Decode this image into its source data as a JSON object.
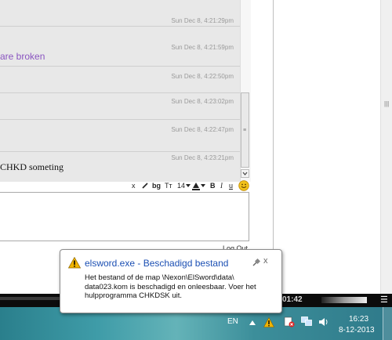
{
  "chat": {
    "messages": [
      {
        "time": "Sun Dec 8, 4:21:29pm",
        "text": ""
      },
      {
        "time": "Sun Dec 8, 4:21:59pm",
        "text": "are broken"
      },
      {
        "time": "Sun Dec 8, 4:22:50pm",
        "text": ""
      },
      {
        "time": "Sun Dec 8, 4:23:02pm",
        "text": ""
      },
      {
        "time": "Sun Dec 8, 4:22:47pm",
        "text": ""
      },
      {
        "time": "Sun Dec 8, 4:23:21pm",
        "text": "CHKD someting"
      }
    ],
    "link_color": "#8a55c0"
  },
  "toolbar": {
    "close": "x",
    "pen": "",
    "bg": "bg",
    "tt": "Tт",
    "size": "14",
    "bold": "B",
    "italic": "I",
    "underline": "u"
  },
  "logout": "Log Out",
  "notification": {
    "title": "elsword.exe - Beschadigd bestand",
    "body": "Het bestand of de map \\Nexon\\ElSword\\data\\ data023.kom is beschadigd en onleesbaar. Voer het hulpprogramma CHKDSK uit.",
    "pin": "",
    "close": "x"
  },
  "mediabar": {
    "time": "01:42"
  },
  "taskbar": {
    "language": "EN",
    "time": "16:23",
    "date": "8-12-2013"
  }
}
